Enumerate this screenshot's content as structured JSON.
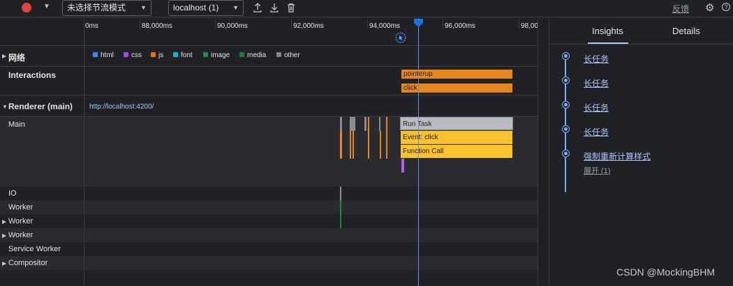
{
  "toolbar": {
    "throttle_value": "未选择节流模式",
    "target_value": "localhost (1)",
    "feedback_label": "反馈",
    "help_glyph": "?"
  },
  "ruler": {
    "ticks": [
      "0ms",
      "88,000ms",
      "90,000ms",
      "92,000ms",
      "94,000ms",
      "96,000ms",
      "98,00"
    ]
  },
  "tracks": {
    "network": {
      "label": "网络",
      "legend": [
        {
          "label": "html",
          "color": "#4285f4"
        },
        {
          "label": "css",
          "color": "#a142f4"
        },
        {
          "label": "js",
          "color": "#e8710a"
        },
        {
          "label": "font",
          "color": "#12b5cb"
        },
        {
          "label": "image",
          "color": "#1e8e3e"
        },
        {
          "label": "media",
          "color": "#188038"
        },
        {
          "label": "other",
          "color": "#80868b"
        }
      ]
    },
    "interactions": {
      "label": "Interactions",
      "items": [
        "pointerup",
        "click"
      ]
    },
    "renderer": {
      "label": "Renderer (main)",
      "url": "http://localhost:4200/"
    },
    "main": {
      "label": "Main",
      "events": [
        "Run Task",
        "Event: click",
        "Function Call"
      ]
    },
    "io": {
      "label": "IO"
    },
    "worker1": {
      "label": "Worker"
    },
    "worker2": {
      "label": "Worker"
    },
    "worker3": {
      "label": "Worker"
    },
    "service_worker": {
      "label": "Service Worker"
    },
    "compositor": {
      "label": "Compositor"
    }
  },
  "sidebar": {
    "tabs": [
      "Insights",
      "Details"
    ],
    "insights": [
      "长任务",
      "长任务",
      "长任务",
      "长任务",
      "强制重新计算样式"
    ],
    "expand_label": "展开 (1)"
  },
  "colors": {
    "accent": "#a8c7fa",
    "record": "#e1443a",
    "js": "#e8710a",
    "run_task": "#b8bcc2",
    "event_click": "#f9c22e"
  },
  "watermark": "CSDN @MockingBHM"
}
